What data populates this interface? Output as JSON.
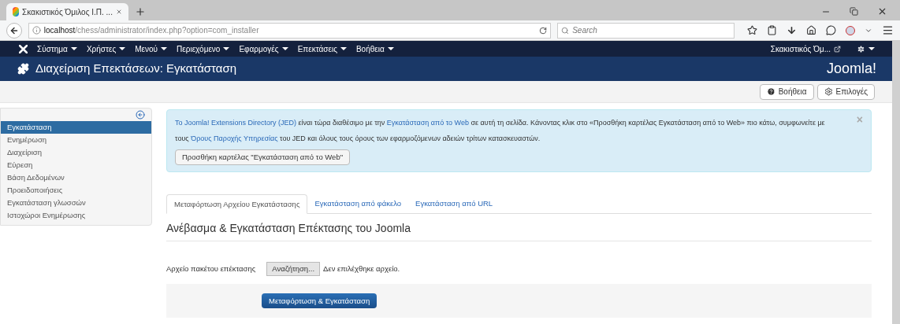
{
  "browser": {
    "tab_title": "Σκακιστικός Όμιλος Ι.Π. ...",
    "url_host": "localhost",
    "url_path": "/chess/administrator/index.php?option=com_installer",
    "search_placeholder": "Search"
  },
  "navbar": {
    "menus": [
      "Σύστημα",
      "Χρήστες",
      "Μενού",
      "Περιεχόμενο",
      "Εφαρμογές",
      "Επεκτάσεις",
      "Βοήθεια"
    ],
    "site_link": "Σκακιστικός Όμ..."
  },
  "header": {
    "title": "Διαχείριση Επεκτάσεων: Εγκατάσταση",
    "logo_text": "Joomla!"
  },
  "toolbar": {
    "buttons": [
      {
        "kind": "help",
        "label": "Βοήθεια"
      },
      {
        "kind": "options",
        "label": "Επιλογές"
      }
    ]
  },
  "sidebar": {
    "items": [
      {
        "label": "Εγκατάσταση",
        "selected": true
      },
      {
        "label": "Ενημέρωση",
        "selected": false
      },
      {
        "label": "Διαχείριση",
        "selected": false
      },
      {
        "label": "Εύρεση",
        "selected": false
      },
      {
        "label": "Βάση Δεδομένων",
        "selected": false
      },
      {
        "label": "Προειδοποιήσεις",
        "selected": false
      },
      {
        "label": "Εγκατάσταση γλωσσών",
        "selected": false
      },
      {
        "label": "Ιστοχώροι Ενημέρωσης",
        "selected": false
      }
    ]
  },
  "alert": {
    "segments": [
      {
        "text": "To Joomla! Extensions Directory (JED)",
        "link": true
      },
      {
        "text": " είναι τώρα διαθέσιμο με την ",
        "link": false
      },
      {
        "text": "Εγκατάσταση από το Web",
        "link": true
      },
      {
        "text": " σε αυτή τη σελίδα.  Κάνοντας κλικ στο «Προσθήκη καρτέλας Εγκατάσταση από το Web» πιο κάτω, συμφωνείτε με τους ",
        "link": false
      },
      {
        "text": "Όρους Παροχής Υπηρεσίας",
        "link": true
      },
      {
        "text": " του JED και όλους τους όρους των εφαρμοζόμενων αδειών τρίτων κατασκευαστών.",
        "link": false
      }
    ],
    "button": "Προσθήκη καρτέλας \"Εγκατάσταση από το Web\"",
    "close": "×"
  },
  "tabs": [
    {
      "label": "Μεταφόρτωση Αρχείου Εγκατάστασης",
      "selected": true
    },
    {
      "label": "Εγκατάσταση από φάκελο",
      "selected": false
    },
    {
      "label": "Εγκατάσταση από URL",
      "selected": false
    }
  ],
  "form": {
    "heading": "Ανέβασμα & Εγκατάσταση Επέκτασης του Joomla",
    "file_label": "Αρχείο πακέτου επέκτασης",
    "browse_button": "Αναζήτηση...",
    "file_status": "Δεν επιλέχθηκε αρχείο.",
    "submit": "Μεταφόρτωση & Εγκατάσταση"
  }
}
